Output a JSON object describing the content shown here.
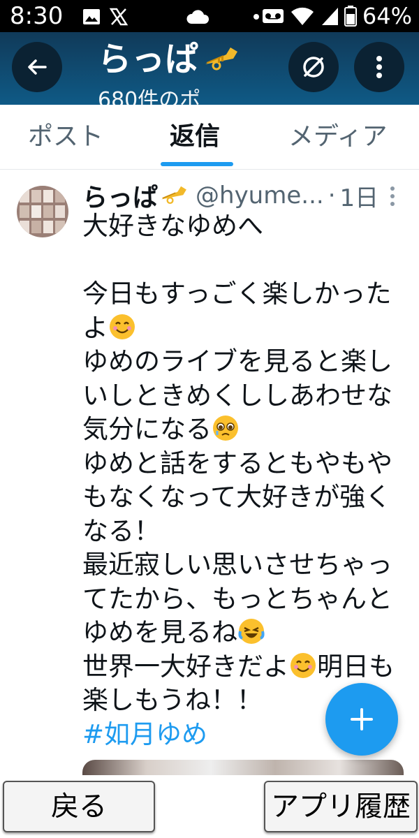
{
  "status_bar": {
    "time": "8:30",
    "battery": "64%",
    "icons": [
      "gallery-icon",
      "x-logo-icon",
      "cloud-icon",
      "dot-icon",
      "voicemail-icon",
      "wifi-icon",
      "signal-icon",
      "battery-icon"
    ]
  },
  "header": {
    "title": "らっぱ",
    "subtitle": "680件のポ",
    "back_icon": "back-arrow-icon",
    "no_symbol_icon": "no-symbol-icon",
    "more_icon": "more-vertical-icon"
  },
  "tabs": [
    {
      "label": "ポスト",
      "active": false
    },
    {
      "label": "返信",
      "active": true
    },
    {
      "label": "メディア",
      "active": false
    }
  ],
  "post": {
    "display_name": "らっぱ",
    "handle": "@hyume...",
    "separator": "·",
    "time": "1日",
    "lines": [
      "大好きなゆめへ",
      "",
      "今日もすっごく楽しかった",
      "よ",
      "ゆめのライブを見ると楽し",
      "いしときめくししあわせな",
      "気分になる",
      "ゆめと話をするともやもや",
      "もなくなって大好きが強く",
      "なる！",
      "最近寂しい思いさせちゃっ",
      "てたから、もっとちゃんと",
      "ゆめを見るね",
      "世界一大好きだよ",
      "明日も",
      "楽しもうね！！"
    ],
    "hashtag": "#如月ゆめ"
  },
  "fab": {
    "icon": "plus-icon"
  },
  "bottom_nav": {
    "back_label": "戻る",
    "history_label": "アプリ履歴"
  },
  "colors": {
    "accent": "#1d9bf0",
    "header_top": "#103a59",
    "header_bottom": "#0f5a86",
    "text": "#0f1419",
    "muted": "#536471"
  }
}
